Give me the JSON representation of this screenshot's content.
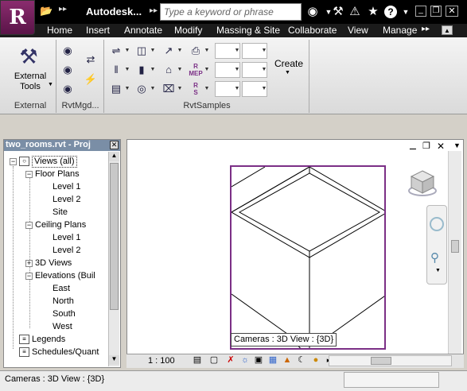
{
  "app": {
    "logo_letter": "R",
    "title": "Autodesk...",
    "search_placeholder": "Type a keyword or phrase"
  },
  "title_icons": [
    "binoculars-icon",
    "tools-icon",
    "star-icon",
    "help-icon",
    "chevron-down-icon"
  ],
  "ribbon_tabs": [
    "Home",
    "Insert",
    "Annotate",
    "Modify",
    "Massing & Site",
    "Collaborate",
    "View",
    "Manage"
  ],
  "ribbon_tabs_overflow": "▸▸",
  "ribbon": {
    "external_tools_label": "External Tools",
    "panel_external": "External",
    "panel_rvtmgd": "RvtMgd...",
    "panel_rvtsamples": "RvtSamples",
    "create_label": "Create",
    "mep_badge": "MEP",
    "s_badge": "S"
  },
  "project_browser": {
    "title": "two_rooms.rvt - Proj",
    "items": [
      {
        "label": "Views (all)",
        "expander": "−"
      },
      {
        "label": "Floor Plans",
        "expander": "−"
      },
      {
        "label": "Level 1",
        "expander": ""
      },
      {
        "label": "Level 2",
        "expander": ""
      },
      {
        "label": "Site",
        "expander": ""
      },
      {
        "label": "Ceiling Plans",
        "expander": "−"
      },
      {
        "label": "Level 1",
        "expander": ""
      },
      {
        "label": "Level 2",
        "expander": ""
      },
      {
        "label": "3D Views",
        "expander": "+"
      },
      {
        "label": "Elevations (Buil",
        "expander": "−"
      },
      {
        "label": "East",
        "expander": ""
      },
      {
        "label": "North",
        "expander": ""
      },
      {
        "label": "South",
        "expander": ""
      },
      {
        "label": "West",
        "expander": ""
      },
      {
        "label": "Legends",
        "expander": ""
      },
      {
        "label": "Schedules/Quant",
        "expander": ""
      }
    ]
  },
  "view": {
    "viewport_label": "Cameras : 3D View : {3D}",
    "scale": "1 : 100"
  },
  "status_bar": {
    "text": "Cameras : 3D View : {3D}"
  },
  "colors": {
    "viewport_border": "#7b2f86",
    "app_button": "#8a2c6e",
    "ribbon_tabs_bg": "#1b1b1b"
  }
}
